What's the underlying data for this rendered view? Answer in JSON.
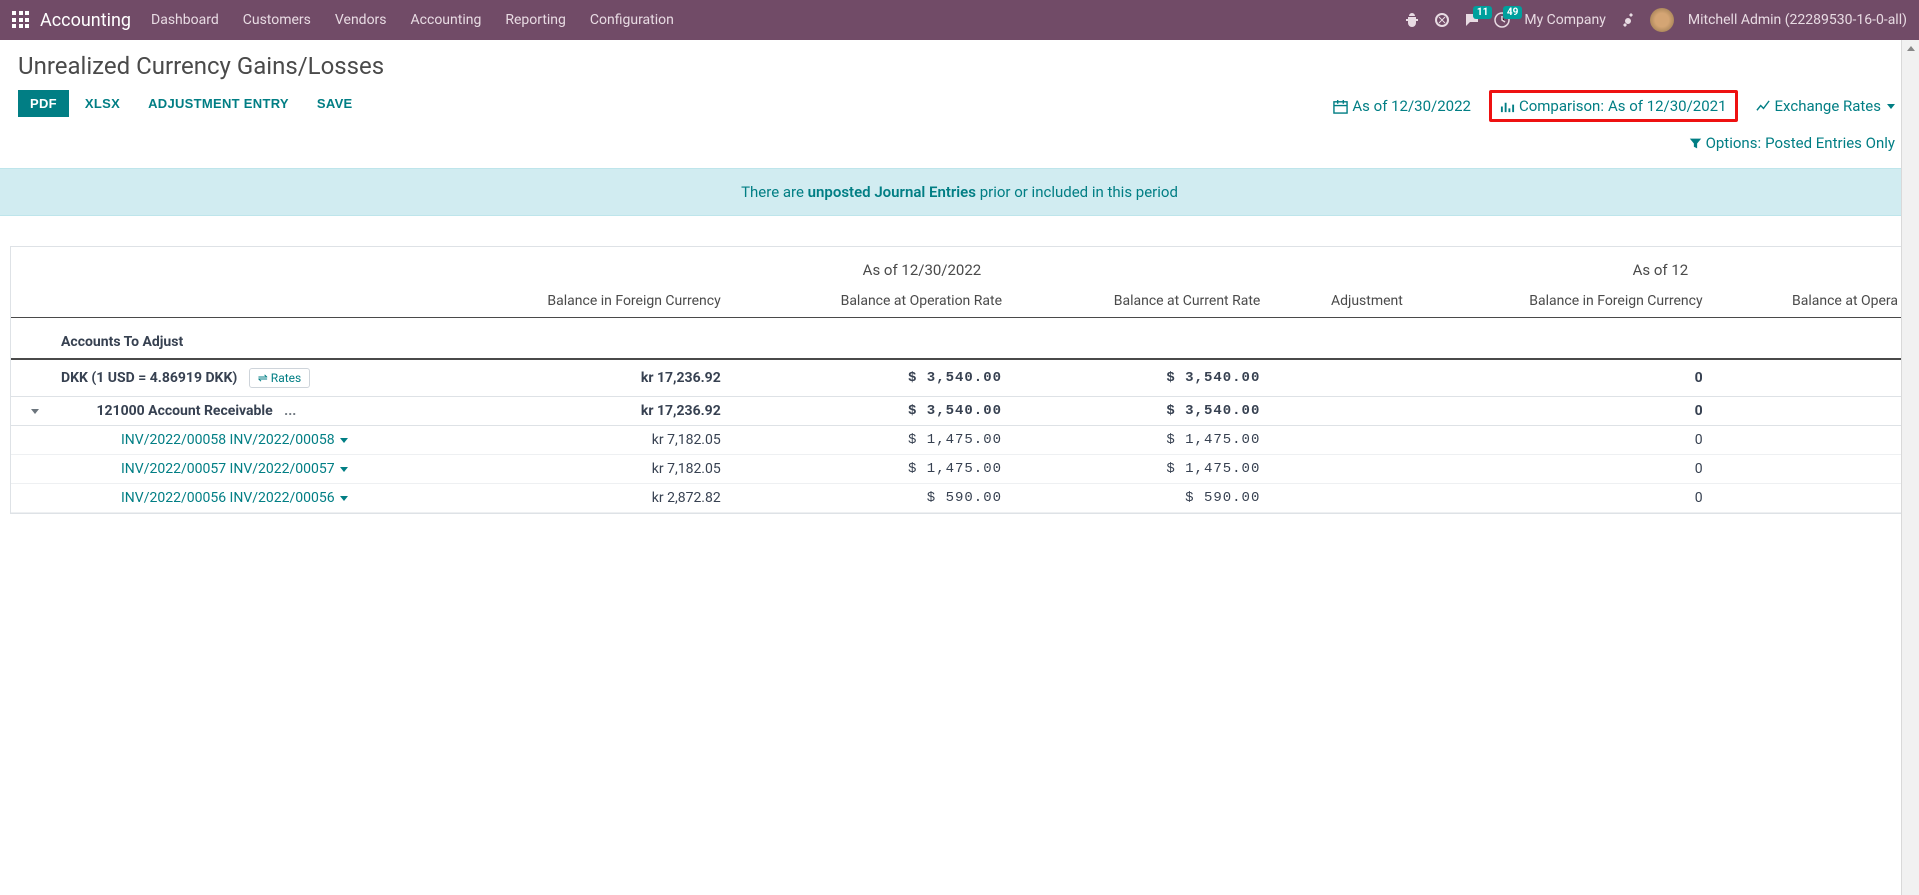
{
  "navbar": {
    "brand": "Accounting",
    "menu": [
      "Dashboard",
      "Customers",
      "Vendors",
      "Accounting",
      "Reporting",
      "Configuration"
    ],
    "messages_badge": "11",
    "activities_badge": "49",
    "company": "My Company",
    "user": "Mitchell Admin (22289530-16-0-all)"
  },
  "page": {
    "title": "Unrealized Currency Gains/Losses",
    "buttons": {
      "pdf": "PDF",
      "xlsx": "XLSX",
      "adjustment": "ADJUSTMENT ENTRY",
      "save": "SAVE"
    },
    "filters": {
      "as_of_label": "As of 12/30/2022",
      "comparison_label": "Comparison:",
      "comparison_value": "As of 12/30/2021",
      "exchange_label": "Exchange Rates",
      "options_label": "Options:",
      "options_value": "Posted Entries Only"
    },
    "banner_prefix": "There are ",
    "banner_link": "unposted Journal Entries",
    "banner_suffix": " prior or included in this period"
  },
  "report": {
    "period1_label": "As of 12/30/2022",
    "period2_label": "As of 12",
    "columns": {
      "foreign": "Balance in Foreign Currency",
      "operation": "Balance at Operation Rate",
      "current": "Balance at Current Rate",
      "adjustment": "Adjustment",
      "foreign2": "Balance in Foreign Currency",
      "operation2": "Balance at Opera"
    },
    "section_label": "Accounts To Adjust",
    "rates_btn": "⇌ Rates",
    "dkk": {
      "label": "DKK (1 USD = 4.86919 DKK)",
      "foreign": "kr 17,236.92",
      "operation": "$ 3,540.00",
      "current": "$ 3,540.00",
      "adjustment": "",
      "foreign2": "0"
    },
    "account": {
      "label": "121000 Account Receivable",
      "foreign": "kr 17,236.92",
      "operation": "$ 3,540.00",
      "current": "$ 3,540.00",
      "adjustment": "",
      "foreign2": "0"
    },
    "invoices": [
      {
        "label": "INV/2022/00058 INV/2022/00058",
        "foreign": "kr 7,182.05",
        "operation": "$ 1,475.00",
        "current": "$ 1,475.00",
        "adjustment": "",
        "foreign2": "0"
      },
      {
        "label": "INV/2022/00057 INV/2022/00057",
        "foreign": "kr 7,182.05",
        "operation": "$ 1,475.00",
        "current": "$ 1,475.00",
        "adjustment": "",
        "foreign2": "0"
      },
      {
        "label": "INV/2022/00056 INV/2022/00056",
        "foreign": "kr 2,872.82",
        "operation": "$ 590.00",
        "current": "$ 590.00",
        "adjustment": "",
        "foreign2": "0"
      }
    ]
  }
}
